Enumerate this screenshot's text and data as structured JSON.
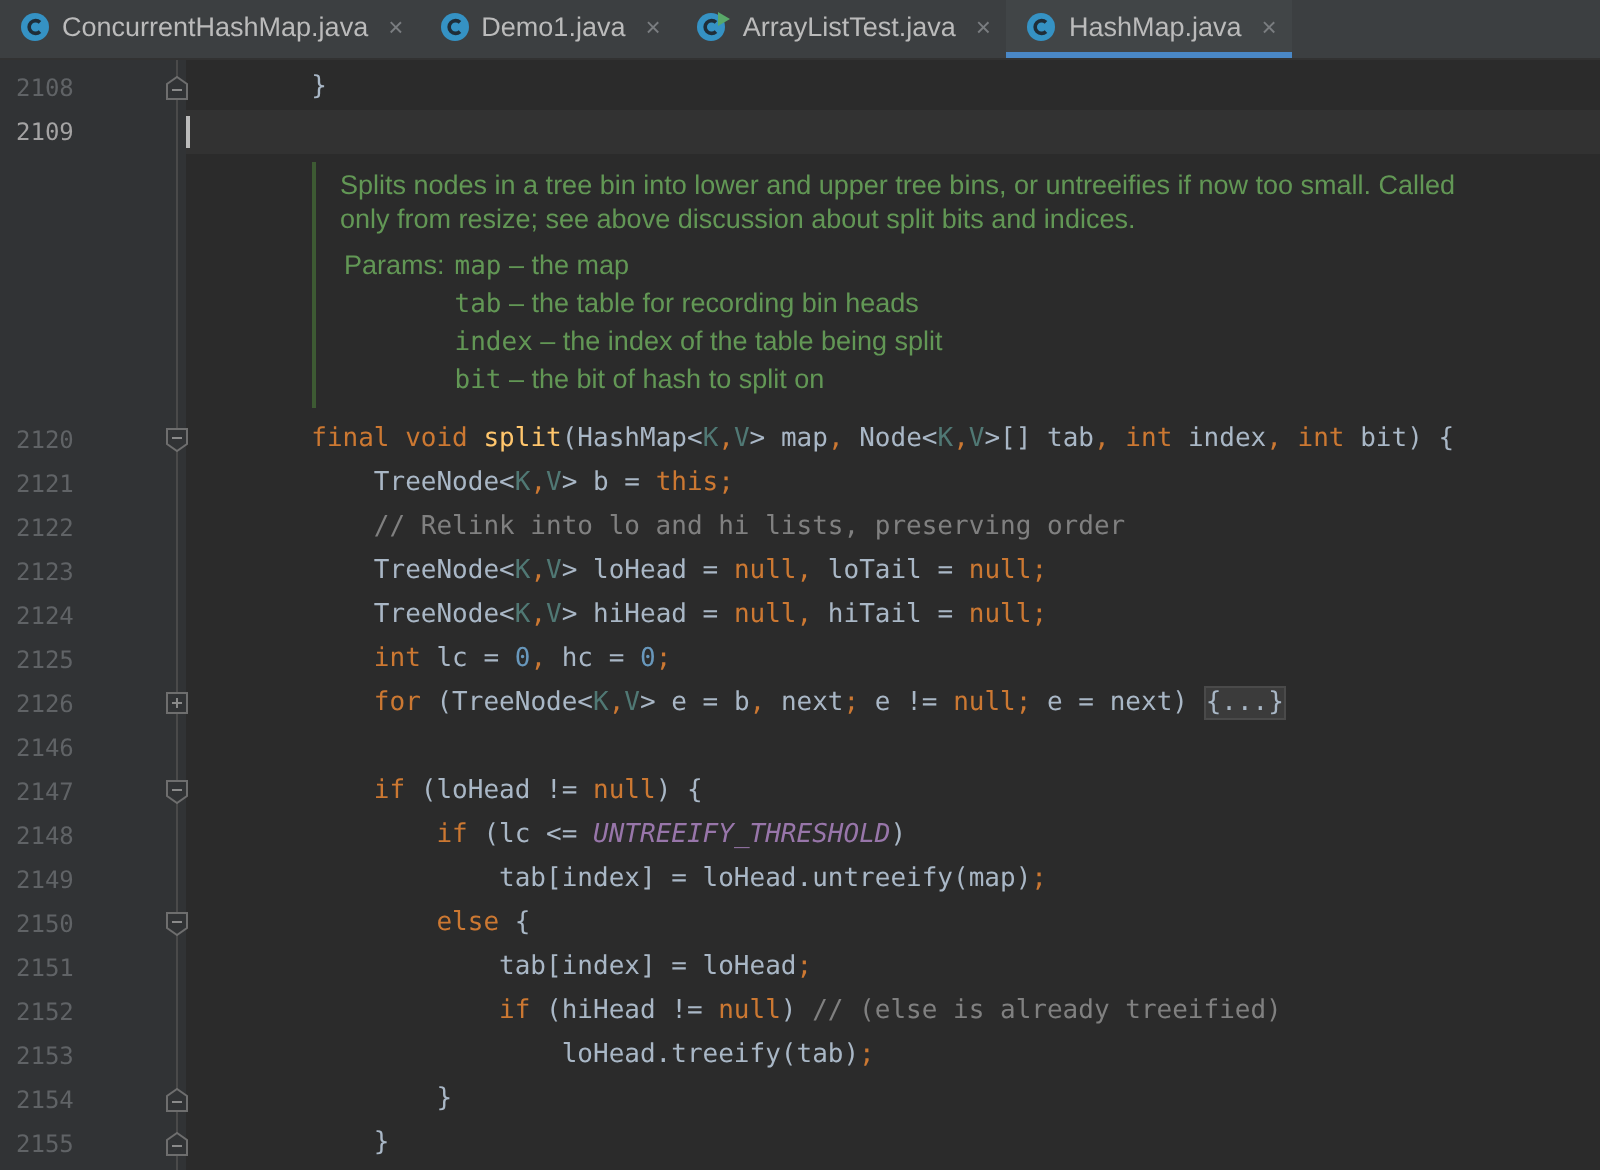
{
  "tabs": [
    {
      "label": "ConcurrentHashMap.java",
      "kind": "class",
      "selected": false,
      "close": "×"
    },
    {
      "label": "Demo1.java",
      "kind": "class",
      "selected": false,
      "close": "×"
    },
    {
      "label": "ArrayListTest.java",
      "kind": "runnable",
      "selected": false,
      "close": "×"
    },
    {
      "label": "HashMap.java",
      "kind": "class",
      "selected": true,
      "close": "×"
    }
  ],
  "lines": [
    {
      "kind": "code",
      "number": "2108",
      "fold_start": false,
      "fold_end": true,
      "collapsed": false,
      "current": false,
      "tokens": [
        {
          "kind": "plain",
          "s": "        }"
        }
      ]
    },
    {
      "kind": "code",
      "number": "2109",
      "fold_start": false,
      "fold_end": false,
      "collapsed": false,
      "current": true
    },
    {
      "kind": "doc",
      "description": "Splits nodes in a tree bin into lower and upper tree bins, or untreeifies if now too small. Called only from resize; see above discussion about split bits and indices.",
      "params_label": "Params:",
      "params": [
        {
          "name": "map",
          "text": "– the map"
        },
        {
          "name": "tab",
          "text": "– the table for recording bin heads"
        },
        {
          "name": "index",
          "text": "– the index of the table being split"
        },
        {
          "name": "bit",
          "text": "– the bit of hash to split on"
        }
      ]
    },
    {
      "kind": "code",
      "number": "2120",
      "fold_start": true,
      "fold_end": false,
      "collapsed": false,
      "current": false,
      "tokens": [
        {
          "kind": "kw",
          "s": "        final void "
        },
        {
          "kind": "fn",
          "s": "split"
        },
        {
          "kind": "plain",
          "s": "(HashMap<"
        },
        {
          "kind": "tp",
          "s": "K"
        },
        {
          "kind": "punct",
          "s": ","
        },
        {
          "kind": "tp",
          "s": "V"
        },
        {
          "kind": "plain",
          "s": "> map"
        },
        {
          "kind": "punct",
          "s": ", "
        },
        {
          "kind": "plain",
          "s": "Node<"
        },
        {
          "kind": "tp",
          "s": "K"
        },
        {
          "kind": "punct",
          "s": ","
        },
        {
          "kind": "tp",
          "s": "V"
        },
        {
          "kind": "plain",
          "s": ">[] tab"
        },
        {
          "kind": "punct",
          "s": ", "
        },
        {
          "kind": "kw",
          "s": "int "
        },
        {
          "kind": "plain",
          "s": "index"
        },
        {
          "kind": "punct",
          "s": ", "
        },
        {
          "kind": "kw",
          "s": "int "
        },
        {
          "kind": "plain",
          "s": "bit) {"
        }
      ]
    },
    {
      "kind": "code",
      "number": "2121",
      "fold_start": false,
      "fold_end": false,
      "collapsed": false,
      "current": false,
      "tokens": [
        {
          "kind": "plain",
          "s": "            TreeNode<"
        },
        {
          "kind": "tp",
          "s": "K"
        },
        {
          "kind": "punct",
          "s": ","
        },
        {
          "kind": "tp",
          "s": "V"
        },
        {
          "kind": "plain",
          "s": "> b = "
        },
        {
          "kind": "kw",
          "s": "this"
        },
        {
          "kind": "punct",
          "s": ";"
        }
      ]
    },
    {
      "kind": "code",
      "number": "2122",
      "fold_start": false,
      "fold_end": false,
      "collapsed": false,
      "current": false,
      "tokens": [
        {
          "kind": "cmt",
          "s": "            // Relink into lo and hi lists, preserving order"
        }
      ]
    },
    {
      "kind": "code",
      "number": "2123",
      "fold_start": false,
      "fold_end": false,
      "collapsed": false,
      "current": false,
      "tokens": [
        {
          "kind": "plain",
          "s": "            TreeNode<"
        },
        {
          "kind": "tp",
          "s": "K"
        },
        {
          "kind": "punct",
          "s": ","
        },
        {
          "kind": "tp",
          "s": "V"
        },
        {
          "kind": "plain",
          "s": "> loHead = "
        },
        {
          "kind": "kw",
          "s": "null"
        },
        {
          "kind": "punct",
          "s": ", "
        },
        {
          "kind": "plain",
          "s": "loTail = "
        },
        {
          "kind": "kw",
          "s": "null"
        },
        {
          "kind": "punct",
          "s": ";"
        }
      ]
    },
    {
      "kind": "code",
      "number": "2124",
      "fold_start": false,
      "fold_end": false,
      "collapsed": false,
      "current": false,
      "tokens": [
        {
          "kind": "plain",
          "s": "            TreeNode<"
        },
        {
          "kind": "tp",
          "s": "K"
        },
        {
          "kind": "punct",
          "s": ","
        },
        {
          "kind": "tp",
          "s": "V"
        },
        {
          "kind": "plain",
          "s": "> hiHead = "
        },
        {
          "kind": "kw",
          "s": "null"
        },
        {
          "kind": "punct",
          "s": ", "
        },
        {
          "kind": "plain",
          "s": "hiTail = "
        },
        {
          "kind": "kw",
          "s": "null"
        },
        {
          "kind": "punct",
          "s": ";"
        }
      ]
    },
    {
      "kind": "code",
      "number": "2125",
      "fold_start": false,
      "fold_end": false,
      "collapsed": false,
      "current": false,
      "tokens": [
        {
          "kind": "kw",
          "s": "            int "
        },
        {
          "kind": "plain",
          "s": "lc = "
        },
        {
          "kind": "num",
          "s": "0"
        },
        {
          "kind": "punct",
          "s": ", "
        },
        {
          "kind": "plain",
          "s": "hc = "
        },
        {
          "kind": "num",
          "s": "0"
        },
        {
          "kind": "punct",
          "s": ";"
        }
      ]
    },
    {
      "kind": "code",
      "number": "2126",
      "fold_start": false,
      "fold_end": false,
      "collapsed": true,
      "current": false,
      "tokens": [
        {
          "kind": "kw",
          "s": "            for "
        },
        {
          "kind": "plain",
          "s": "(TreeNode<"
        },
        {
          "kind": "tp",
          "s": "K"
        },
        {
          "kind": "punct",
          "s": ","
        },
        {
          "kind": "tp",
          "s": "V"
        },
        {
          "kind": "plain",
          "s": "> e = b"
        },
        {
          "kind": "punct",
          "s": ", "
        },
        {
          "kind": "plain",
          "s": "next"
        },
        {
          "kind": "punct",
          "s": "; "
        },
        {
          "kind": "plain",
          "s": "e != "
        },
        {
          "kind": "kw",
          "s": "null"
        },
        {
          "kind": "punct",
          "s": "; "
        },
        {
          "kind": "plain",
          "s": "e = next) "
        },
        {
          "kind": "folded",
          "s": "{...}"
        }
      ]
    },
    {
      "kind": "code",
      "number": "2146",
      "fold_start": false,
      "fold_end": false,
      "collapsed": false,
      "current": false
    },
    {
      "kind": "code",
      "number": "2147",
      "fold_start": true,
      "fold_end": false,
      "collapsed": false,
      "current": false,
      "tokens": [
        {
          "kind": "kw",
          "s": "            if "
        },
        {
          "kind": "plain",
          "s": "(loHead != "
        },
        {
          "kind": "kw",
          "s": "null"
        },
        {
          "kind": "plain",
          "s": ") {"
        }
      ]
    },
    {
      "kind": "code",
      "number": "2148",
      "fold_start": false,
      "fold_end": false,
      "collapsed": false,
      "current": false,
      "tokens": [
        {
          "kind": "kw",
          "s": "                if "
        },
        {
          "kind": "plain",
          "s": "(lc <= "
        },
        {
          "kind": "const",
          "s": "UNTREEIFY_THRESHOLD"
        },
        {
          "kind": "plain",
          "s": ")"
        }
      ]
    },
    {
      "kind": "code",
      "number": "2149",
      "fold_start": false,
      "fold_end": false,
      "collapsed": false,
      "current": false,
      "tokens": [
        {
          "kind": "plain",
          "s": "                    tab[index] = loHead.untreeify(map)"
        },
        {
          "kind": "punct",
          "s": ";"
        }
      ]
    },
    {
      "kind": "code",
      "number": "2150",
      "fold_start": true,
      "fold_end": false,
      "collapsed": false,
      "current": false,
      "tokens": [
        {
          "kind": "kw",
          "s": "                else "
        },
        {
          "kind": "plain",
          "s": "{"
        }
      ]
    },
    {
      "kind": "code",
      "number": "2151",
      "fold_start": false,
      "fold_end": false,
      "collapsed": false,
      "current": false,
      "tokens": [
        {
          "kind": "plain",
          "s": "                    tab[index] = loHead"
        },
        {
          "kind": "punct",
          "s": ";"
        }
      ]
    },
    {
      "kind": "code",
      "number": "2152",
      "fold_start": false,
      "fold_end": false,
      "collapsed": false,
      "current": false,
      "tokens": [
        {
          "kind": "kw",
          "s": "                    if "
        },
        {
          "kind": "plain",
          "s": "(hiHead != "
        },
        {
          "kind": "kw",
          "s": "null"
        },
        {
          "kind": "plain",
          "s": ") "
        },
        {
          "kind": "cmt",
          "s": "// (else is already treeified)"
        }
      ]
    },
    {
      "kind": "code",
      "number": "2153",
      "fold_start": false,
      "fold_end": false,
      "collapsed": false,
      "current": false,
      "tokens": [
        {
          "kind": "plain",
          "s": "                        loHead.treeify(tab)"
        },
        {
          "kind": "punct",
          "s": ";"
        }
      ]
    },
    {
      "kind": "code",
      "number": "2154",
      "fold_start": false,
      "fold_end": true,
      "collapsed": false,
      "current": false,
      "tokens": [
        {
          "kind": "plain",
          "s": "                }"
        }
      ]
    },
    {
      "kind": "code",
      "number": "2155",
      "fold_start": false,
      "fold_end": true,
      "collapsed": false,
      "current": false,
      "tokens": [
        {
          "kind": "plain",
          "s": "            }"
        }
      ]
    }
  ]
}
